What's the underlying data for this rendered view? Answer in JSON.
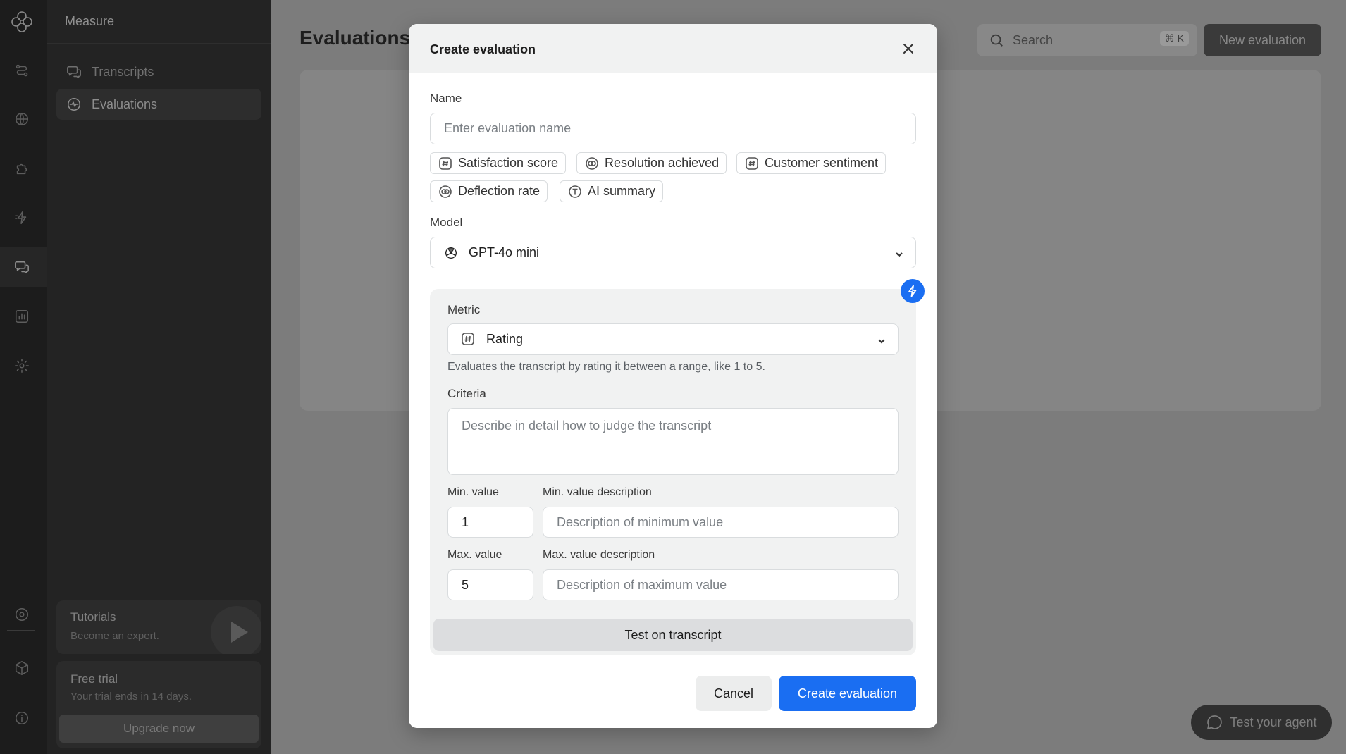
{
  "sidebar": {
    "title": "Measure",
    "items": [
      {
        "label": "Transcripts"
      },
      {
        "label": "Evaluations"
      }
    ],
    "tutorials": {
      "title": "Tutorials",
      "subtitle": "Become an expert."
    },
    "trial": {
      "title": "Free trial",
      "subtitle": "Your trial ends in 14 days.",
      "button": "Upgrade now"
    }
  },
  "main": {
    "title": "Evaluations",
    "search_placeholder": "Search",
    "search_shortcut": "⌘ K",
    "new_button": "New evaluation",
    "test_agent": "Test your agent"
  },
  "modal": {
    "title": "Create evaluation",
    "name_label": "Name",
    "name_placeholder": "Enter evaluation name",
    "chips": [
      {
        "label": "Satisfaction score",
        "icon": "hash-icon"
      },
      {
        "label": "Resolution achieved",
        "icon": "toggle-icon"
      },
      {
        "label": "Customer sentiment",
        "icon": "hash-icon"
      },
      {
        "label": "Deflection rate",
        "icon": "toggle-icon"
      },
      {
        "label": "AI summary",
        "icon": "text-icon"
      }
    ],
    "model_label": "Model",
    "model_value": "GPT-4o mini",
    "metric_label": "Metric",
    "metric_value": "Rating",
    "metric_hint": "Evaluates the transcript by rating it between a range, like 1 to 5.",
    "criteria_label": "Criteria",
    "criteria_placeholder": "Describe in detail how to judge the transcript",
    "min_label": "Min. value",
    "min_value": "1",
    "min_desc_label": "Min. value description",
    "min_desc_placeholder": "Description of minimum value",
    "max_label": "Max. value",
    "max_value": "5",
    "max_desc_label": "Max. value description",
    "max_desc_placeholder": "Description of maximum value",
    "test_button": "Test on transcript",
    "cancel_button": "Cancel",
    "create_button": "Create evaluation"
  },
  "colors": {
    "accent": "#1a6ef2",
    "overlay": "#7c7c7c",
    "rail": "#1c1c1c",
    "sidebar": "#232323"
  }
}
